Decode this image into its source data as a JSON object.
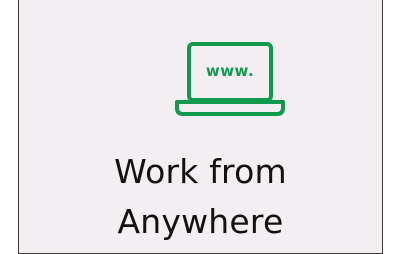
{
  "tile": {
    "icon": "laptop-web-icon",
    "icon_text": "www.",
    "title_line1": "Work from",
    "title_line2": "Anywhere",
    "accent_color": "#0f9b4b",
    "background": "#f2eef2"
  }
}
